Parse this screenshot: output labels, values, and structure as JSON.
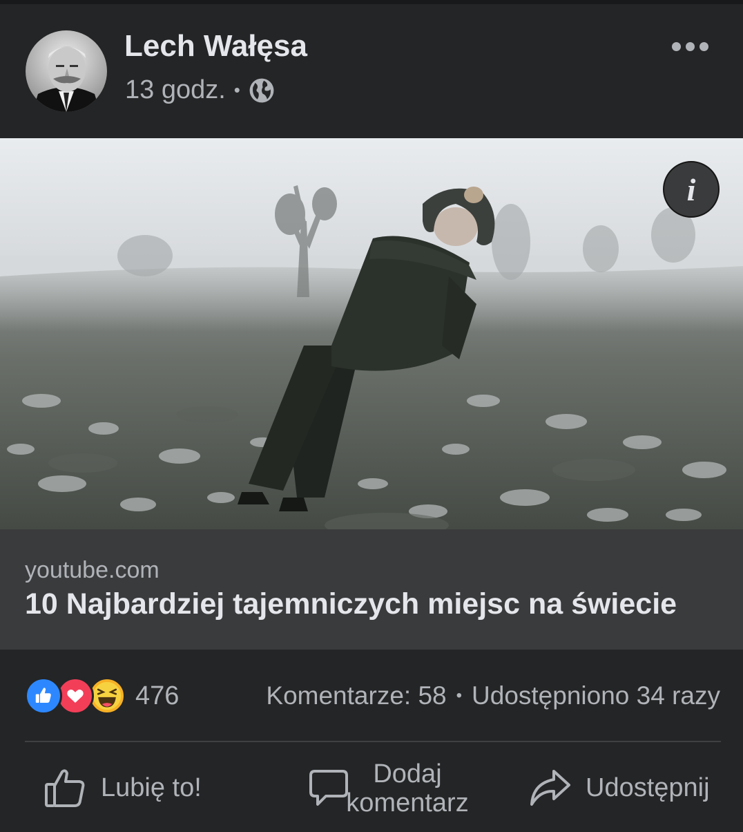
{
  "post": {
    "author": "Lech Wałęsa",
    "time": "13 godz.",
    "separator": "•",
    "privacy_icon": "globe-icon",
    "more_icon": "more-options-icon"
  },
  "media": {
    "info_label": "i"
  },
  "link_preview": {
    "domain": "youtube.com",
    "title": "10 Najbardziej tajemniczych miejsc na świecie"
  },
  "engagement": {
    "reaction_icons": [
      "like-reaction-icon",
      "love-reaction-icon",
      "haha-reaction-icon"
    ],
    "reaction_count": "476",
    "comments": "Komentarze: 58",
    "separator": "•",
    "shares": "Udostępniono 34 razy"
  },
  "actions": {
    "like_label": "Lubię to!",
    "comment_label": "Dodaj komentarz",
    "share_label": "Udostępnij"
  },
  "colors": {
    "background": "#242526",
    "link_box": "#3a3b3c",
    "primary_text": "#e4e6eb",
    "secondary_text": "#b0b3b8",
    "like_blue": "#2d88ff",
    "love_red": "#f33e58",
    "haha_yellow": "#f7b125"
  }
}
